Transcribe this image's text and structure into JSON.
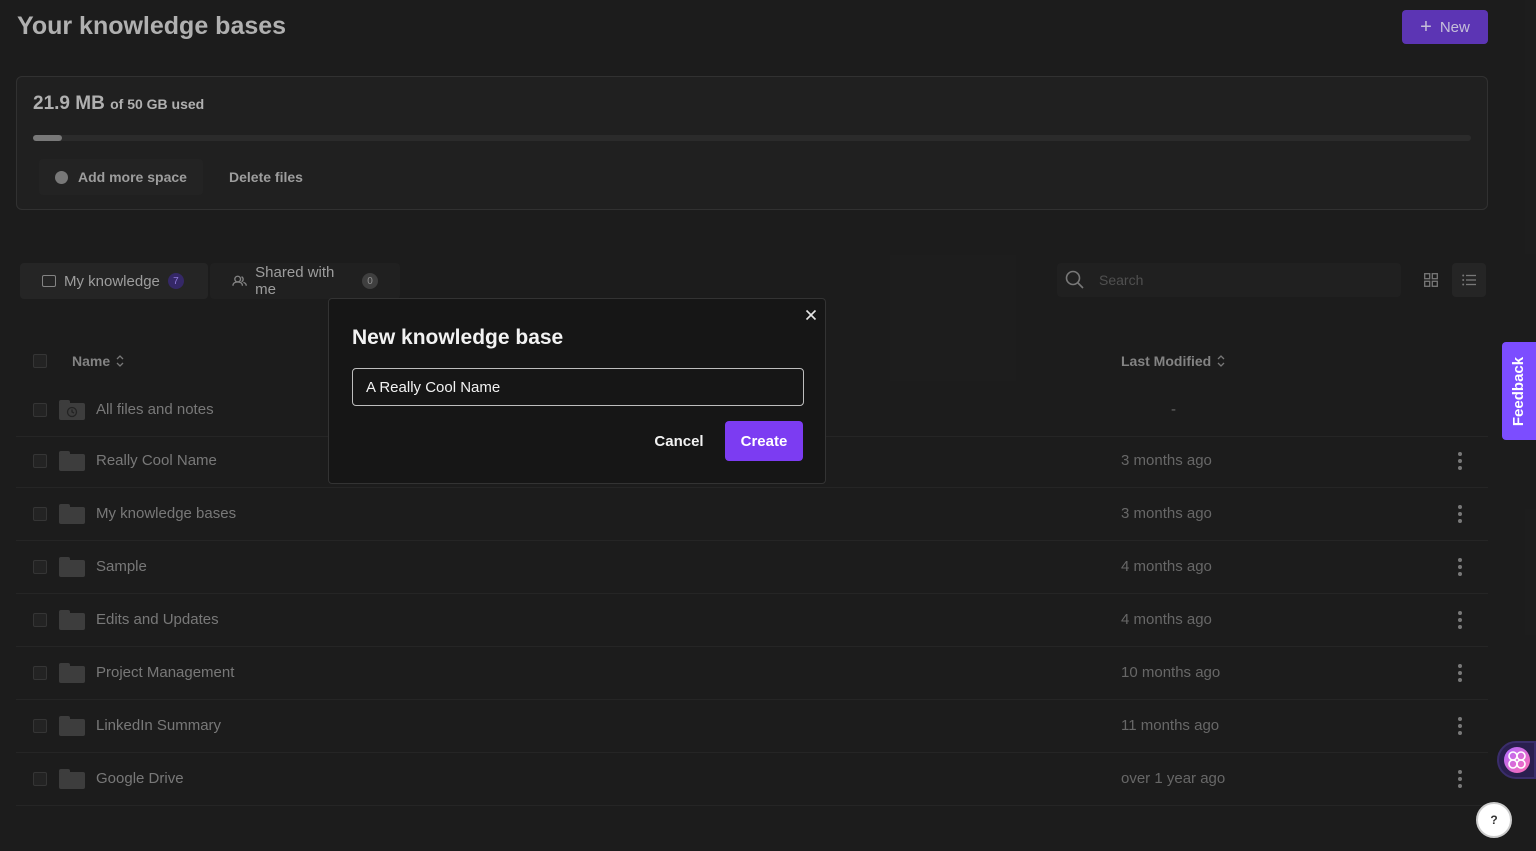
{
  "header": {
    "title": "Your knowledge bases",
    "new_label": "New"
  },
  "storage": {
    "used": "21.9 MB",
    "of_total": "of 50 GB used",
    "used_fraction": 0.0004,
    "add_space_label": "Add more space",
    "delete_files_label": "Delete files"
  },
  "tabs": [
    {
      "label": "My knowledge",
      "count": "7",
      "active": true
    },
    {
      "label": "Shared with me",
      "count": "0",
      "active": false
    }
  ],
  "search": {
    "placeholder": "Search"
  },
  "table": {
    "columns": {
      "name": "Name",
      "last_modified": "Last Modified"
    },
    "rows": [
      {
        "name": "All files and notes",
        "modified": "-",
        "kind": "all-files"
      },
      {
        "name": "Really Cool Name",
        "modified": "3 months ago",
        "kind": "folder"
      },
      {
        "name": "My knowledge bases",
        "modified": "3 months ago",
        "kind": "folder"
      },
      {
        "name": "Sample",
        "modified": "4 months ago",
        "kind": "folder"
      },
      {
        "name": "Edits and Updates",
        "modified": "4 months ago",
        "kind": "folder"
      },
      {
        "name": "Project Management",
        "modified": "10 months ago",
        "kind": "folder"
      },
      {
        "name": "LinkedIn Summary",
        "modified": "11 months ago",
        "kind": "folder"
      },
      {
        "name": "Google Drive",
        "modified": "over 1 year ago",
        "kind": "folder"
      }
    ]
  },
  "modal": {
    "title": "New knowledge base",
    "input_value": "A Really Cool Name",
    "cancel_label": "Cancel",
    "create_label": "Create"
  },
  "side": {
    "feedback_label": "Feedback",
    "help_label": "?"
  },
  "colors": {
    "accent": "#7c3cf2",
    "feedback": "#7c4dff",
    "background": "#222222",
    "modal_background": "#161616"
  }
}
